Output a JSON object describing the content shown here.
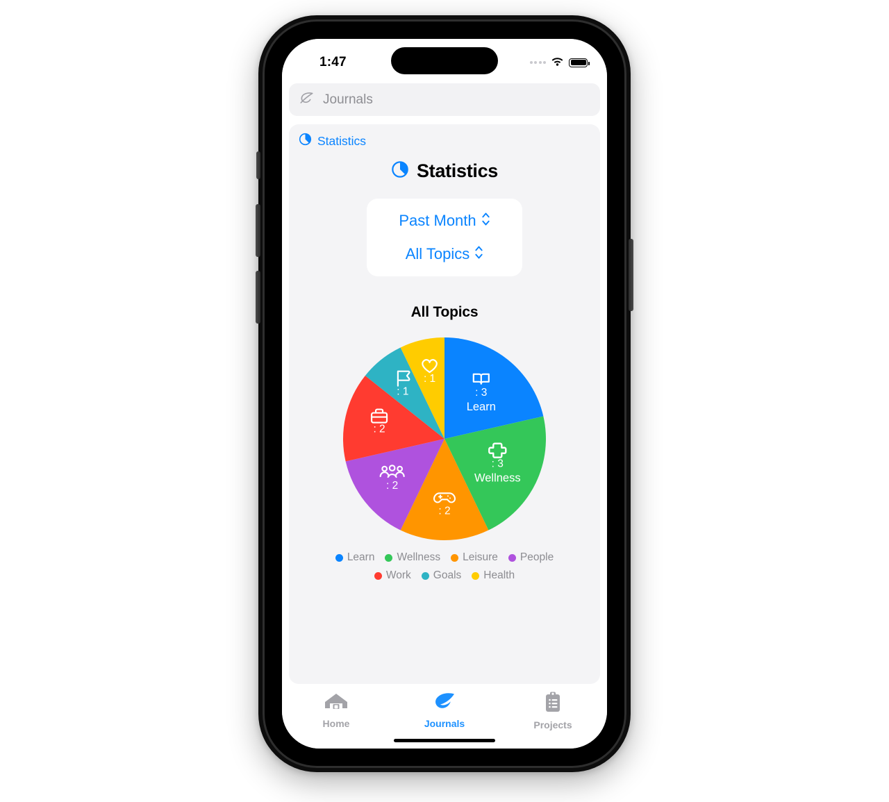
{
  "status_bar": {
    "time": "1:47",
    "cellular_icon": "cellular-dots-icon",
    "wifi_icon": "wifi-icon",
    "battery_icon": "battery-full-icon"
  },
  "search": {
    "icon": "leaf-icon",
    "value": "Journals",
    "placeholder": "Journals"
  },
  "breadcrumb": {
    "icon": "pie-chart-icon",
    "label": "Statistics"
  },
  "header": {
    "icon": "pie-chart-icon",
    "title": "Statistics"
  },
  "pickers": [
    {
      "name": "time-range-picker",
      "label": "Past Month",
      "icon": "chevron-up-down-icon"
    },
    {
      "name": "topic-picker",
      "label": "All Topics",
      "icon": "chevron-up-down-icon"
    }
  ],
  "chart_section": {
    "title": "All Topics"
  },
  "chart_data": {
    "type": "pie",
    "title": "All Topics",
    "total": 14,
    "start_angle_deg": 0,
    "direction": "clockwise",
    "legend_position": "bottom",
    "categories": [
      "Learn",
      "Wellness",
      "Leisure",
      "People",
      "Work",
      "Goals",
      "Health"
    ],
    "values": [
      3,
      3,
      2,
      2,
      2,
      1,
      1
    ],
    "colors": [
      "#0a84ff",
      "#34c759",
      "#ff9500",
      "#af52de",
      "#ff3b30",
      "#2eb3c4",
      "#ffcc00"
    ],
    "slices": [
      {
        "label": "Learn",
        "value": 3,
        "value_text": ": 3",
        "color": "#0a84ff",
        "icon": "book-icon",
        "show_label_in_slice": true
      },
      {
        "label": "Wellness",
        "value": 3,
        "value_text": ": 3",
        "color": "#34c759",
        "icon": "cross-icon",
        "show_label_in_slice": true
      },
      {
        "label": "Leisure",
        "value": 2,
        "value_text": ": 2",
        "color": "#ff9500",
        "icon": "gamepad-icon",
        "show_label_in_slice": false
      },
      {
        "label": "People",
        "value": 2,
        "value_text": ": 2",
        "color": "#af52de",
        "icon": "people-icon",
        "show_label_in_slice": false
      },
      {
        "label": "Work",
        "value": 2,
        "value_text": ": 2",
        "color": "#ff3b30",
        "icon": "briefcase-icon",
        "show_label_in_slice": false
      },
      {
        "label": "Goals",
        "value": 1,
        "value_text": ": 1",
        "color": "#2eb3c4",
        "icon": "flag-icon",
        "show_label_in_slice": false
      },
      {
        "label": "Health",
        "value": 1,
        "value_text": ": 1",
        "color": "#ffcc00",
        "icon": "heart-icon",
        "show_label_in_slice": false
      }
    ]
  },
  "tabbar": {
    "items": [
      {
        "label": "Home",
        "icon": "home-icon",
        "active": false
      },
      {
        "label": "Journals",
        "icon": "leaf-icon",
        "active": true
      },
      {
        "label": "Projects",
        "icon": "clipboard-icon",
        "active": false
      }
    ]
  },
  "theme": {
    "accent": "#0a84ff",
    "muted_text": "#8e8e93",
    "panel_bg": "#f4f4f6"
  }
}
